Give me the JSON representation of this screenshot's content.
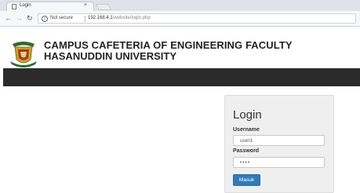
{
  "browser": {
    "tab_title": "Login",
    "tab_close": "×",
    "not_secure": "Not secure",
    "url_host": "192.168.4.1",
    "url_path": "/website/login.php"
  },
  "header": {
    "title_line1": "CAMPUS CAFETERIA OF ENGINEERING FACULTY",
    "title_line2": "HASANUDDIN UNIVERSITY"
  },
  "login": {
    "heading": "Login",
    "username_label": "Username",
    "username_value": "user1",
    "password_label": "Password",
    "password_value": "••••",
    "submit_label": "Masuk"
  }
}
